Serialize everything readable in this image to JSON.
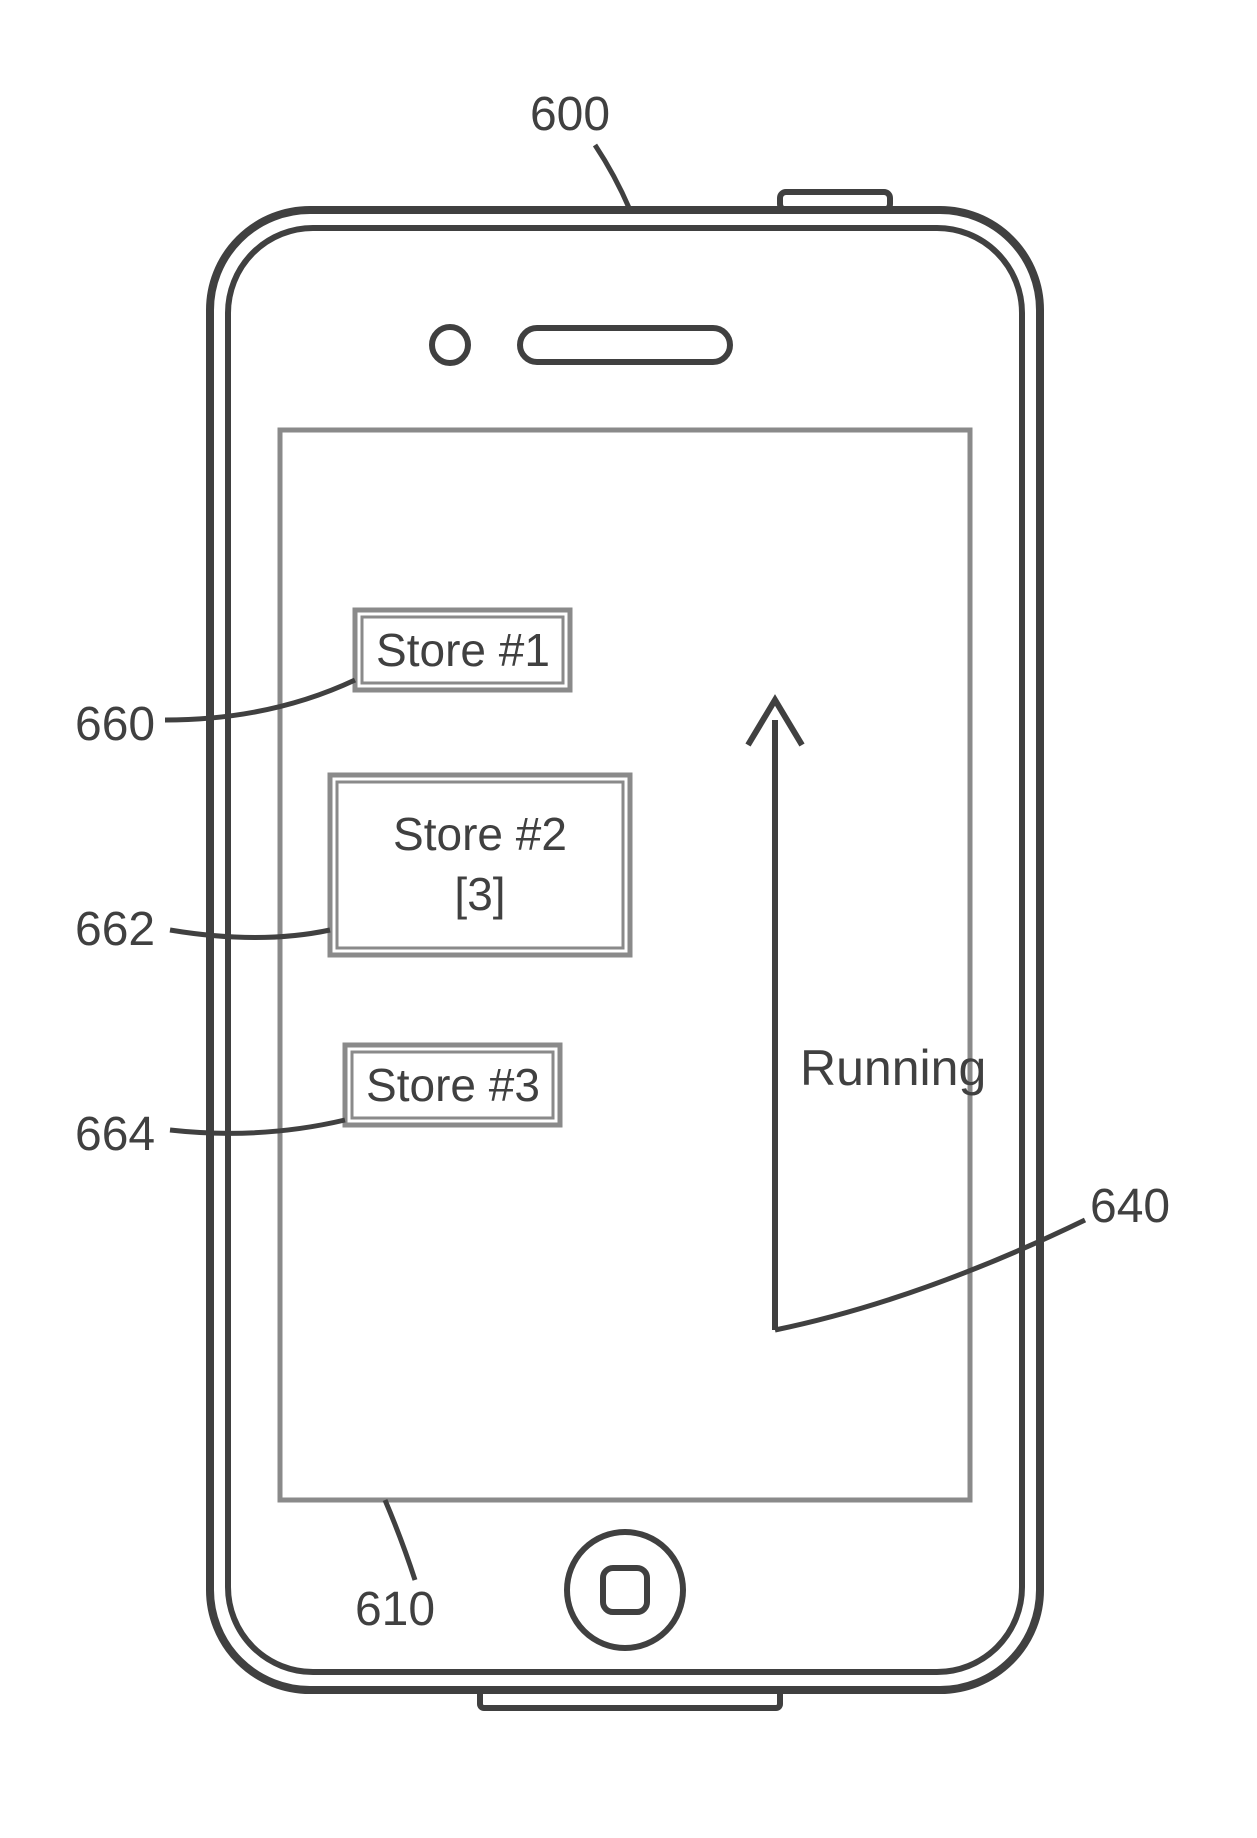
{
  "diagram": {
    "device_ref": "600",
    "screen_ref": "610",
    "arrow_ref": "640",
    "arrow_label": "Running",
    "boxes": {
      "store1": {
        "label": "Store #1",
        "ref": "660"
      },
      "store2": {
        "label_line1": "Store #2",
        "label_line2": "[3]",
        "ref": "662"
      },
      "store3": {
        "label": "Store #3",
        "ref": "664"
      }
    }
  }
}
